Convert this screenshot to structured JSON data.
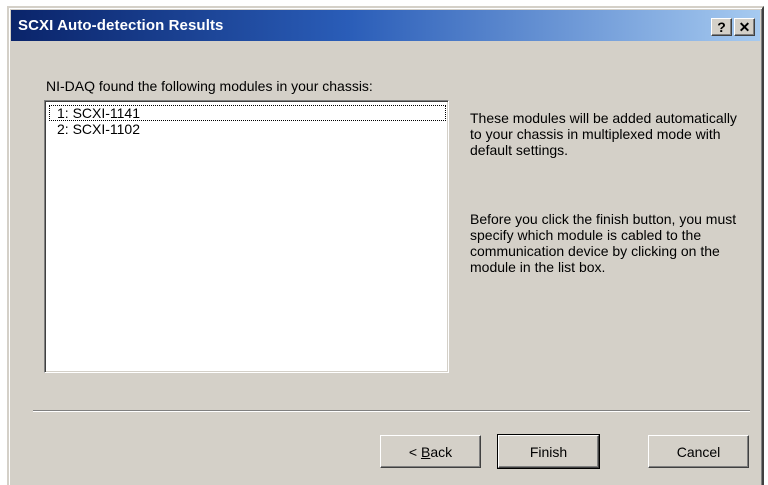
{
  "window": {
    "title": "SCXI Auto-detection Results",
    "help_button": "?",
    "close_button": "✕"
  },
  "prompt": "NI-DAQ found the following modules in your chassis:",
  "modules": [
    {
      "label": "1: SCXI-1141"
    },
    {
      "label": "2: SCXI-1102"
    }
  ],
  "info": {
    "paragraph1": "These modules will be added automatically to your chassis in multiplexed mode with default settings.",
    "paragraph2": "Before you click the finish button, you must specify which module is cabled to the communication device by clicking on the module in the list box."
  },
  "buttons": {
    "back_prefix": "< ",
    "back_mnemonic": "B",
    "back_rest": "ack",
    "finish": "Finish",
    "cancel": "Cancel"
  },
  "colors": {
    "titlebar_start": "#0a246a",
    "titlebar_end": "#a6caf0",
    "face": "#d4d0c8"
  }
}
